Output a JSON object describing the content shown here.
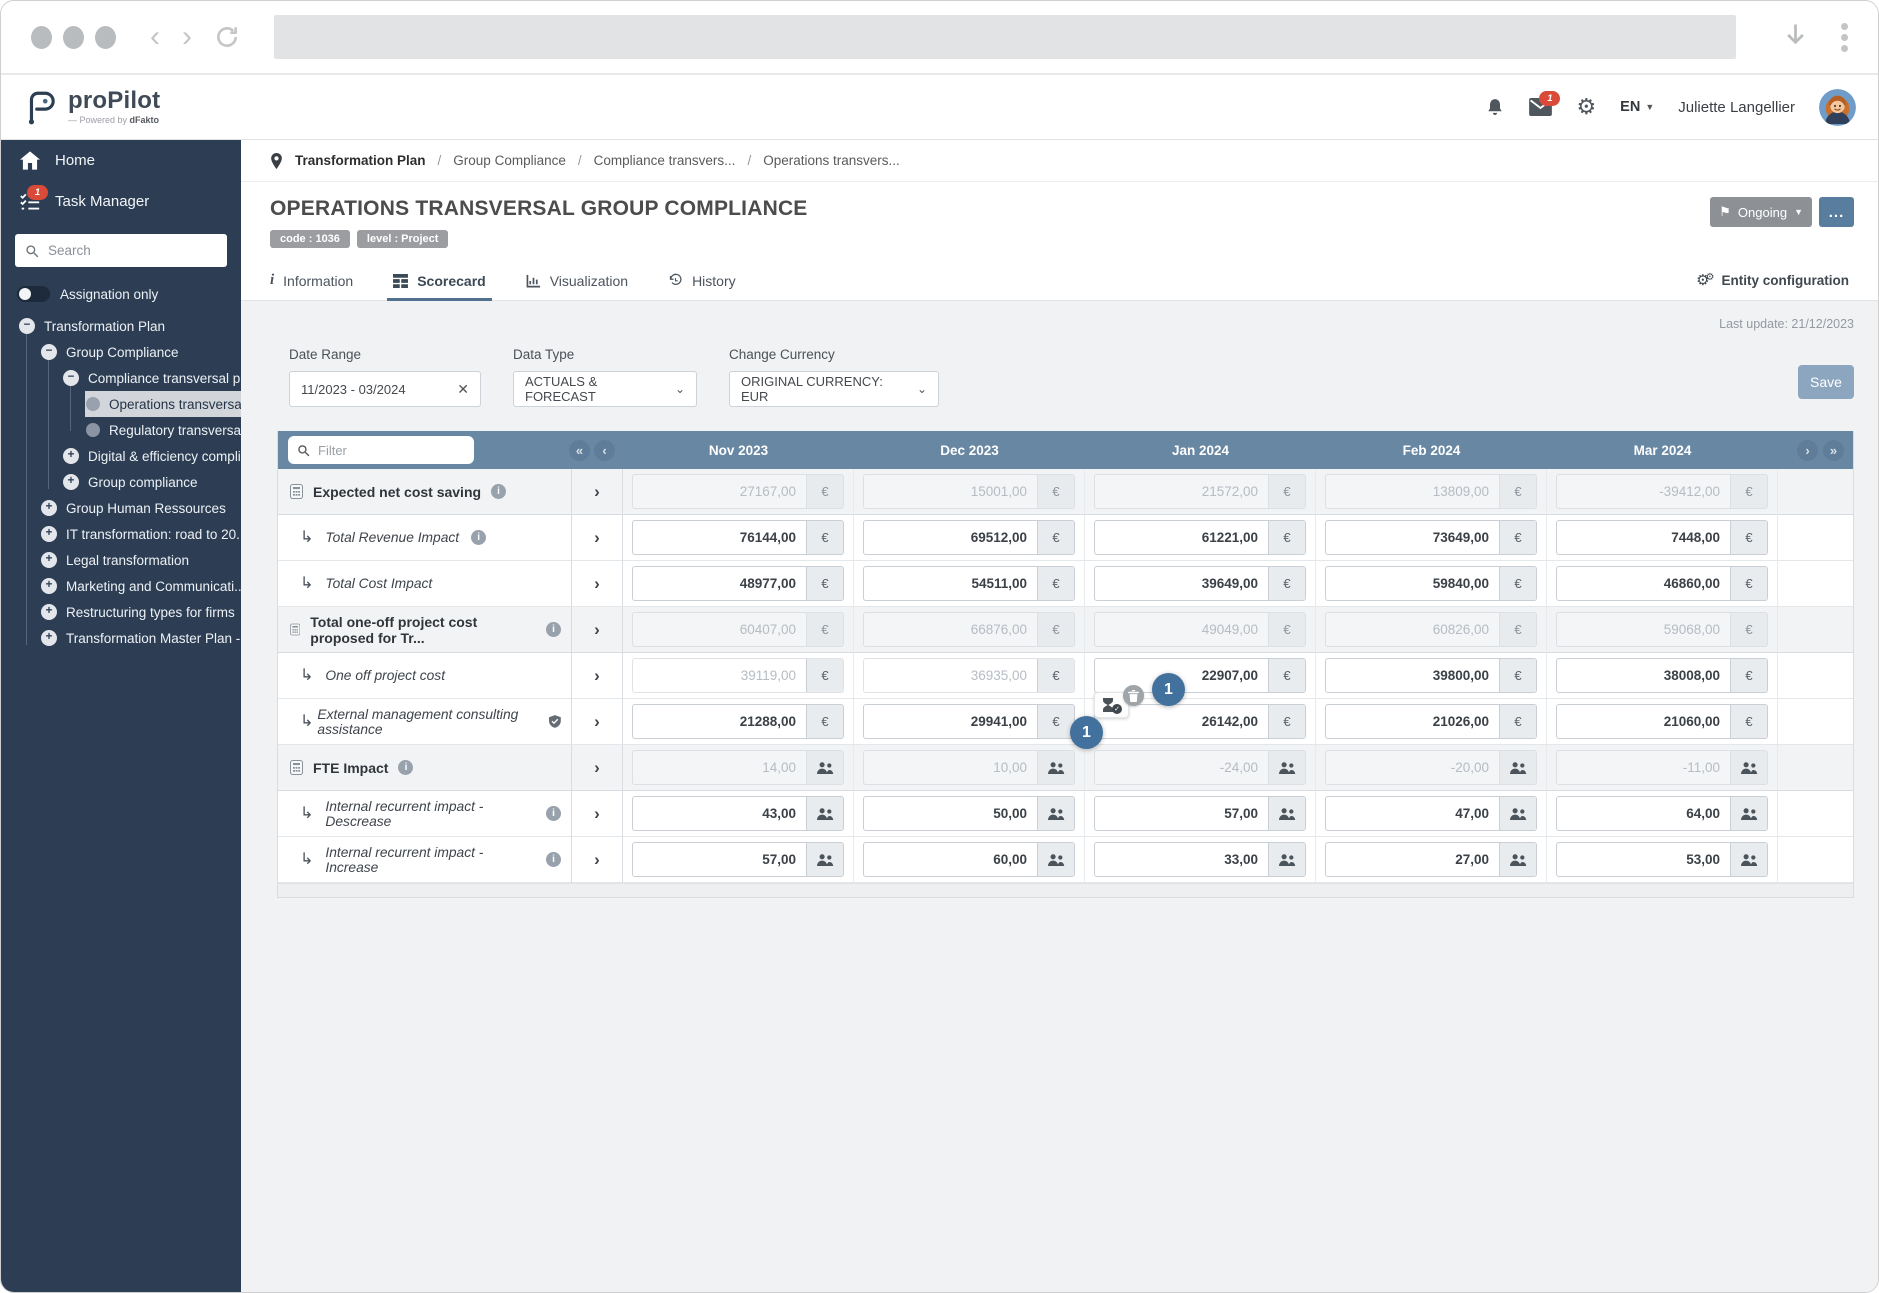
{
  "browser": {
    "address": ""
  },
  "header": {
    "logo": "proPilot",
    "logo_sub_prefix": "— Powered by ",
    "logo_sub_brand": "dFakto",
    "mail_badge": "1",
    "language": "EN",
    "language_caret": "▼",
    "user_name": "Juliette Langellier"
  },
  "sidebar": {
    "home": "Home",
    "task_manager": "Task Manager",
    "task_badge": "1",
    "search_placeholder": "Search",
    "assignation_label": "Assignation only",
    "tree": [
      {
        "label": "Transformation Plan",
        "level": 0,
        "state": "expanded",
        "active": false
      },
      {
        "label": "Group Compliance",
        "level": 1,
        "state": "expanded",
        "active": false
      },
      {
        "label": "Compliance transversal pr...",
        "level": 2,
        "state": "expanded",
        "active": false
      },
      {
        "label": "Operations transversal ...",
        "level": 3,
        "state": "leaf",
        "active": true
      },
      {
        "label": "Regulatory transversal ...",
        "level": 3,
        "state": "leaf",
        "active": false
      },
      {
        "label": "Digital & efficiency compli...",
        "level": 2,
        "state": "collapsed",
        "active": false
      },
      {
        "label": "Group compliance",
        "level": 2,
        "state": "collapsed",
        "active": false
      },
      {
        "label": "Group Human Ressources",
        "level": 1,
        "state": "collapsed",
        "active": false
      },
      {
        "label": "IT transformation: road to 20...",
        "level": 1,
        "state": "collapsed",
        "active": false
      },
      {
        "label": "Legal transformation",
        "level": 1,
        "state": "collapsed",
        "active": false
      },
      {
        "label": "Marketing and Communicati...",
        "level": 1,
        "state": "collapsed",
        "active": false
      },
      {
        "label": "Restructuring types for firms",
        "level": 1,
        "state": "collapsed",
        "active": false
      },
      {
        "label": "Transformation Master Plan -...",
        "level": 1,
        "state": "collapsed",
        "active": false
      }
    ]
  },
  "breadcrumb": {
    "items": [
      "Transformation Plan",
      "Group Compliance",
      "Compliance transvers...",
      "Operations transvers..."
    ]
  },
  "page": {
    "title": "OPERATIONS TRANSVERSAL GROUP COMPLIANCE",
    "badges": [
      "code : 1036",
      "level : Project"
    ],
    "status_label": "Ongoing",
    "status_flag": "⚑",
    "more_label": "...",
    "last_update": "Last update: 21/12/2023"
  },
  "tabs": {
    "items": [
      {
        "label": "Information"
      },
      {
        "label": "Scorecard"
      },
      {
        "label": "Visualization"
      },
      {
        "label": "History"
      }
    ],
    "entity_config": "Entity configuration"
  },
  "filters": {
    "date_range_label": "Date Range",
    "date_range_value": "11/2023 - 03/2024",
    "data_type_label": "Data Type",
    "data_type_value": "ACTUALS & FORECAST",
    "currency_label": "Change Currency",
    "currency_value": "ORIGINAL CURRENCY: EUR",
    "save_label": "Save"
  },
  "scorecard": {
    "filter_placeholder": "Filter",
    "months": [
      "Nov 2023",
      "Dec 2023",
      "Jan 2024",
      "Feb 2024",
      "Mar 2024"
    ],
    "euro_symbol": "€",
    "rows": [
      {
        "label": "Expected net cost saving",
        "style": "parent",
        "info": true,
        "shield": false,
        "unit": "eur",
        "values": [
          "27167,00",
          "15001,00",
          "21572,00",
          "13809,00",
          "-39412,00"
        ],
        "states": [
          "disabled",
          "disabled",
          "disabled",
          "disabled",
          "disabled"
        ]
      },
      {
        "label": "Total Revenue Impact",
        "style": "child",
        "info": true,
        "shield": false,
        "unit": "eur",
        "values": [
          "76144,00",
          "69512,00",
          "61221,00",
          "73649,00",
          "7448,00"
        ],
        "states": [
          "editable",
          "editable",
          "editable",
          "editable",
          "editable"
        ]
      },
      {
        "label": "Total Cost Impact",
        "style": "child",
        "info": false,
        "shield": false,
        "unit": "eur",
        "values": [
          "48977,00",
          "54511,00",
          "39649,00",
          "59840,00",
          "46860,00"
        ],
        "states": [
          "editable",
          "editable",
          "editable",
          "editable",
          "editable"
        ]
      },
      {
        "label": "Total one-off project cost proposed for Tr...",
        "style": "parent",
        "info": true,
        "shield": false,
        "unit": "eur",
        "values": [
          "60407,00",
          "66876,00",
          "49049,00",
          "60826,00",
          "59068,00"
        ],
        "states": [
          "disabled",
          "disabled",
          "disabled",
          "disabled",
          "disabled"
        ]
      },
      {
        "label": "One off project cost",
        "style": "child",
        "info": false,
        "shield": false,
        "unit": "eur",
        "values": [
          "39119,00",
          "36935,00",
          "22907,00",
          "39800,00",
          "38008,00"
        ],
        "states": [
          "muted",
          "muted",
          "editable",
          "editable",
          "editable"
        ]
      },
      {
        "label": "External management consulting assistance",
        "style": "child",
        "info": false,
        "shield": true,
        "unit": "eur",
        "values": [
          "21288,00",
          "29941,00",
          "26142,00",
          "21026,00",
          "21060,00"
        ],
        "states": [
          "editable",
          "editable",
          "editable",
          "editable",
          "editable"
        ]
      },
      {
        "label": "FTE Impact",
        "style": "parent",
        "info": true,
        "shield": false,
        "unit": "fte",
        "values": [
          "14,00",
          "10,00",
          "-24,00",
          "-20,00",
          "-11,00"
        ],
        "states": [
          "disabled",
          "disabled",
          "disabled",
          "disabled",
          "disabled"
        ]
      },
      {
        "label": "Internal recurrent impact - Descrease",
        "style": "child",
        "info": true,
        "shield": false,
        "unit": "fte",
        "values": [
          "43,00",
          "50,00",
          "57,00",
          "47,00",
          "64,00"
        ],
        "states": [
          "editable",
          "editable",
          "editable",
          "editable",
          "editable"
        ]
      },
      {
        "label": "Internal recurrent impact - Increase",
        "style": "child",
        "info": true,
        "shield": false,
        "unit": "fte",
        "values": [
          "57,00",
          "60,00",
          "33,00",
          "27,00",
          "53,00"
        ],
        "states": [
          "editable",
          "editable",
          "editable",
          "editable",
          "editable"
        ]
      }
    ]
  },
  "overlay": {
    "marker_top": "1",
    "marker_bottom": "1"
  },
  "colors": {
    "sidebar_navy": "#2d3e54",
    "table_header_blue": "#6887a3",
    "badge_blue": "#41719c",
    "save_blue": "#8ca6bf",
    "accent_red": "#d94b38"
  }
}
